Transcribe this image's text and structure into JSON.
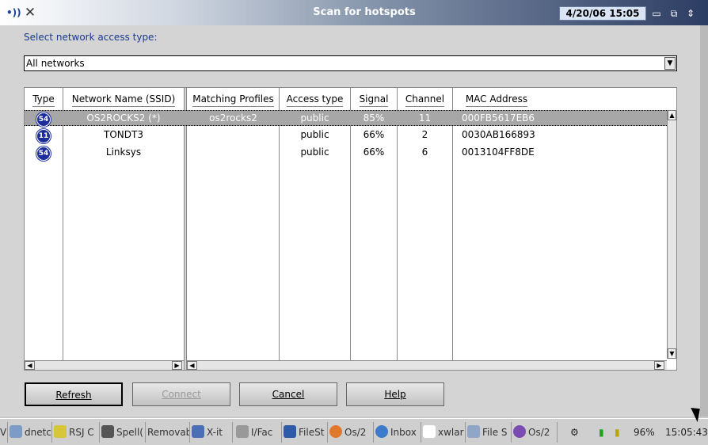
{
  "window": {
    "title": "Scan for hotspots",
    "datetime": "4/20/06 15:05"
  },
  "dialog": {
    "access_type_label": "Select network access type:",
    "access_type_value": "All networks"
  },
  "table": {
    "columns": [
      "Type",
      "Network Name (SSID)",
      "Matching Profiles",
      "Access type",
      "Signal",
      "Channel",
      "MAC Address"
    ],
    "rows": [
      {
        "type": "54",
        "ssid": "OS2ROCKS2 (*)",
        "profile": "os2rocks2",
        "access": "public",
        "signal": "85%",
        "channel": "11",
        "mac": "000FB5617EB6",
        "selected": true
      },
      {
        "type": "11",
        "ssid": "TONDT3",
        "profile": "",
        "access": "public",
        "signal": "66%",
        "channel": "2",
        "mac": "0030AB166893",
        "selected": false
      },
      {
        "type": "54",
        "ssid": "Linksys",
        "profile": "",
        "access": "public",
        "signal": "66%",
        "channel": "6",
        "mac": "0013104FF8DE",
        "selected": false
      }
    ]
  },
  "buttons": {
    "refresh": "Refresh",
    "connect": "Connect",
    "cancel": "Cancel",
    "help": "Help"
  },
  "taskbar": {
    "items": [
      "dnetc",
      "RSJ C",
      "Spell(",
      "Removab",
      "X-it",
      "I/Fac",
      "FileSt",
      "Os/2",
      "Inbox",
      "xwlar",
      "File S",
      "Os/2"
    ],
    "battery": "96%",
    "clock": "15:05:43"
  },
  "icons": {
    "app": "wireless-signal-icon",
    "close": "close-x-icon"
  }
}
